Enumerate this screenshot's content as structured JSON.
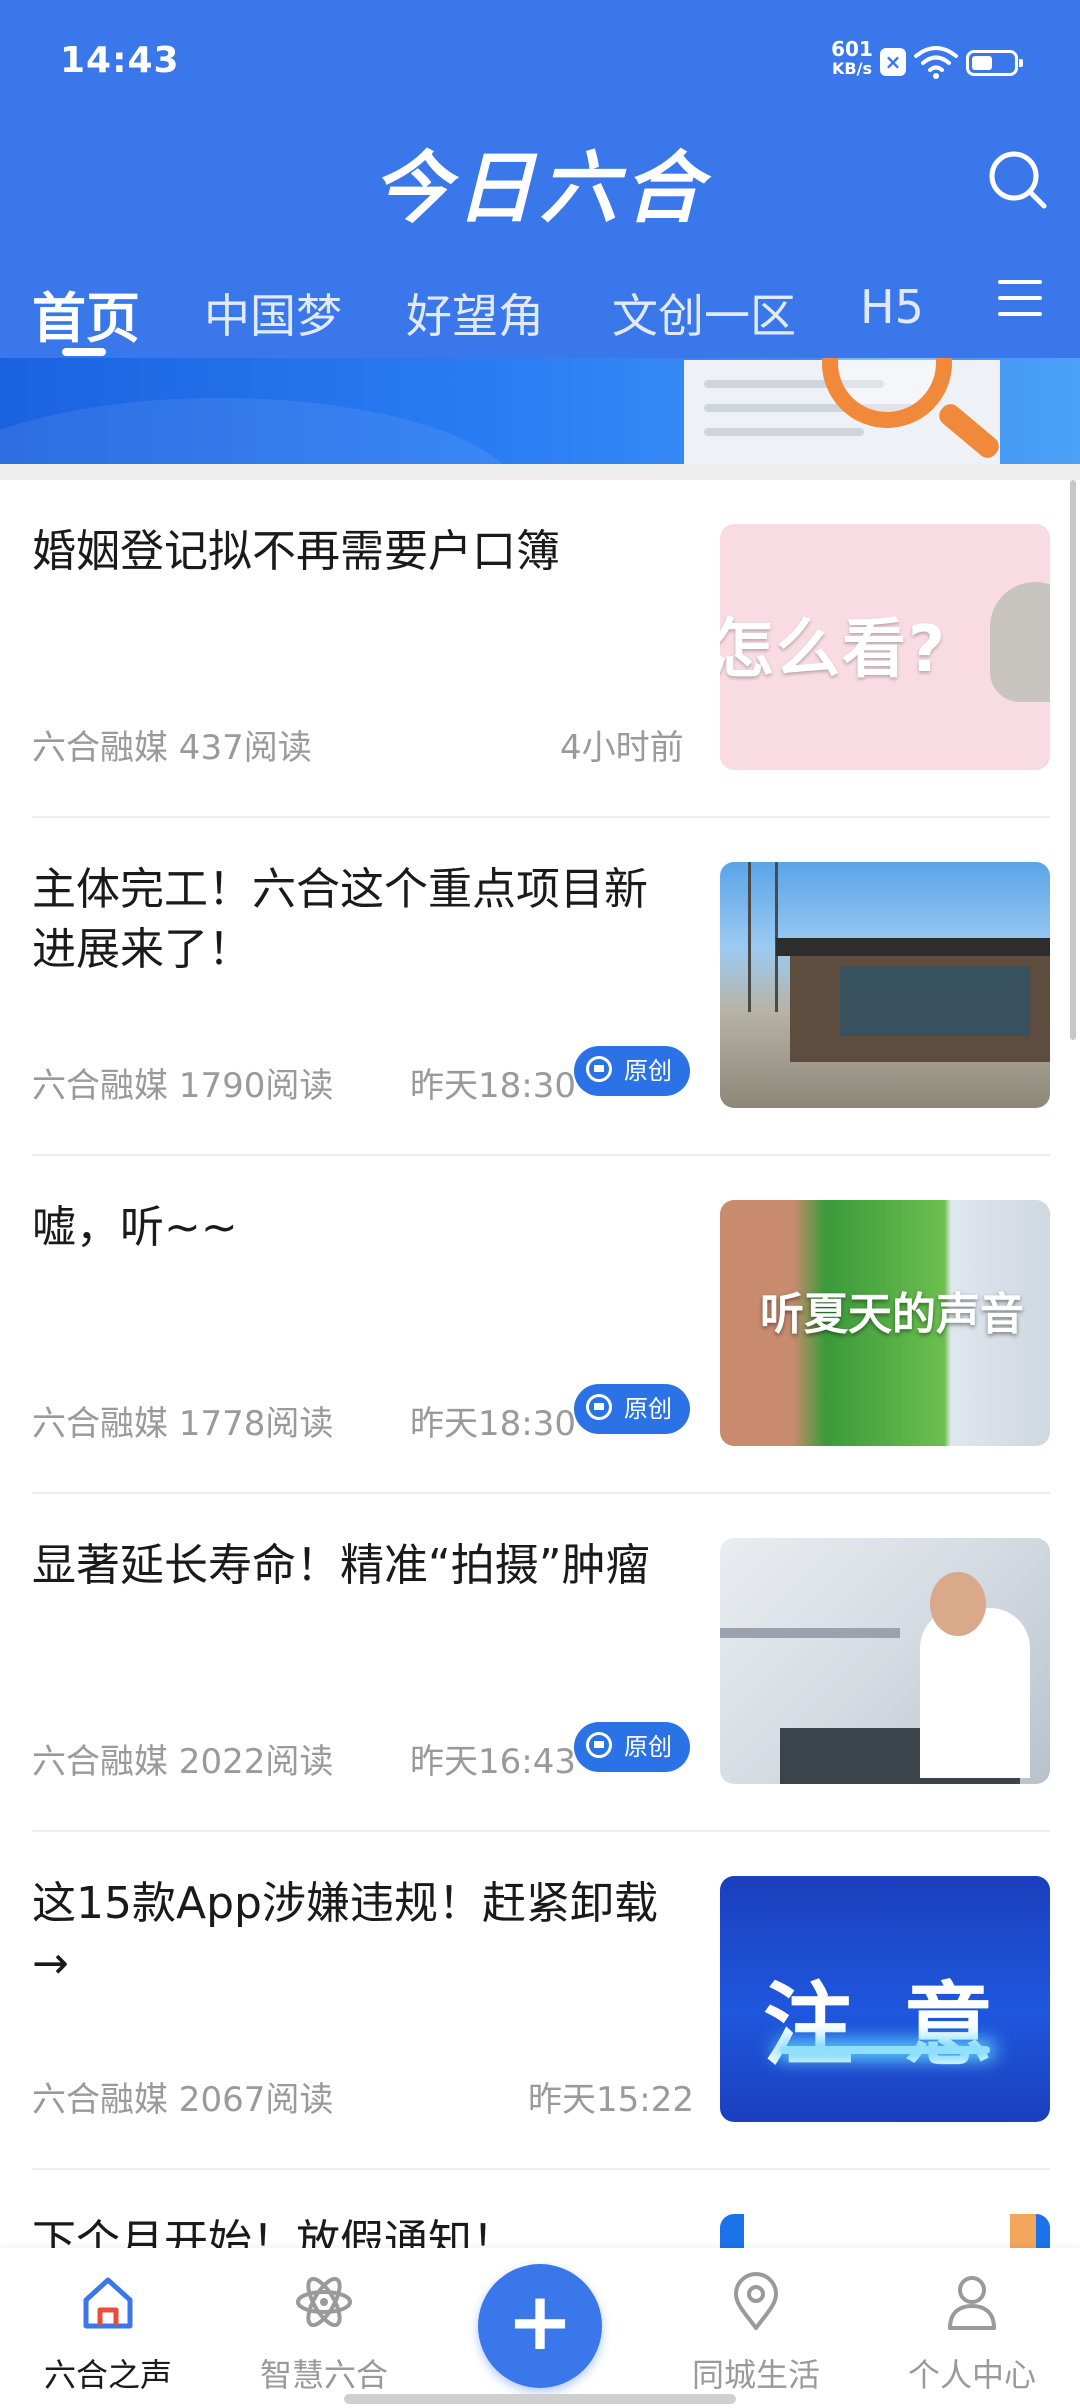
{
  "status_bar": {
    "time": "14:43",
    "net_speed_value": "601",
    "net_speed_unit": "KB/s",
    "icons": [
      "sim-x-icon",
      "wifi-icon",
      "battery-icon"
    ]
  },
  "header": {
    "app_title": "今日六合",
    "accent_color": "#3a77ea",
    "tabs": [
      {
        "label": "首页",
        "active": true
      },
      {
        "label": "中国梦"
      },
      {
        "label": "好望角"
      },
      {
        "label": "文创一区"
      },
      {
        "label": "H5"
      }
    ],
    "icons": [
      "search-icon",
      "menu-icon"
    ]
  },
  "news": [
    {
      "title": "婚姻登记拟不再需要户口簿",
      "meta": "六合融媒 437阅读",
      "time": "4小时前",
      "original": false,
      "thumb_text": "怎么看?"
    },
    {
      "title": "主体完工！六合这个重点项目新进展来了！",
      "meta": "六合融媒 1790阅读",
      "time": "昨天18:30",
      "original": true
    },
    {
      "title": "嘘，听~~",
      "meta": "六合融媒 1778阅读",
      "time": "昨天18:30",
      "original": true,
      "thumb_text": "听夏天的声音"
    },
    {
      "title": "显著延长寿命！精准“拍摄”肿瘤",
      "meta": "六合融媒 2022阅读",
      "time": "昨天16:43",
      "original": true
    },
    {
      "title": "这15款App涉嫌违规！赶紧卸载→",
      "meta": "六合融媒 2067阅读",
      "time": "昨天15:22",
      "original": false,
      "thumb_text": "注意"
    },
    {
      "title": "下个月开始！放假通知！",
      "meta": "",
      "time": "",
      "original": false
    }
  ],
  "original_badge_label": "原创",
  "bottom_nav": [
    {
      "label": "六合之声",
      "icon": "home-icon",
      "active": true
    },
    {
      "label": "智慧六合",
      "icon": "atom-icon"
    },
    {
      "label": "",
      "icon": "plus-icon"
    },
    {
      "label": "同城生活",
      "icon": "location-pin-icon"
    },
    {
      "label": "个人中心",
      "icon": "person-icon"
    }
  ]
}
